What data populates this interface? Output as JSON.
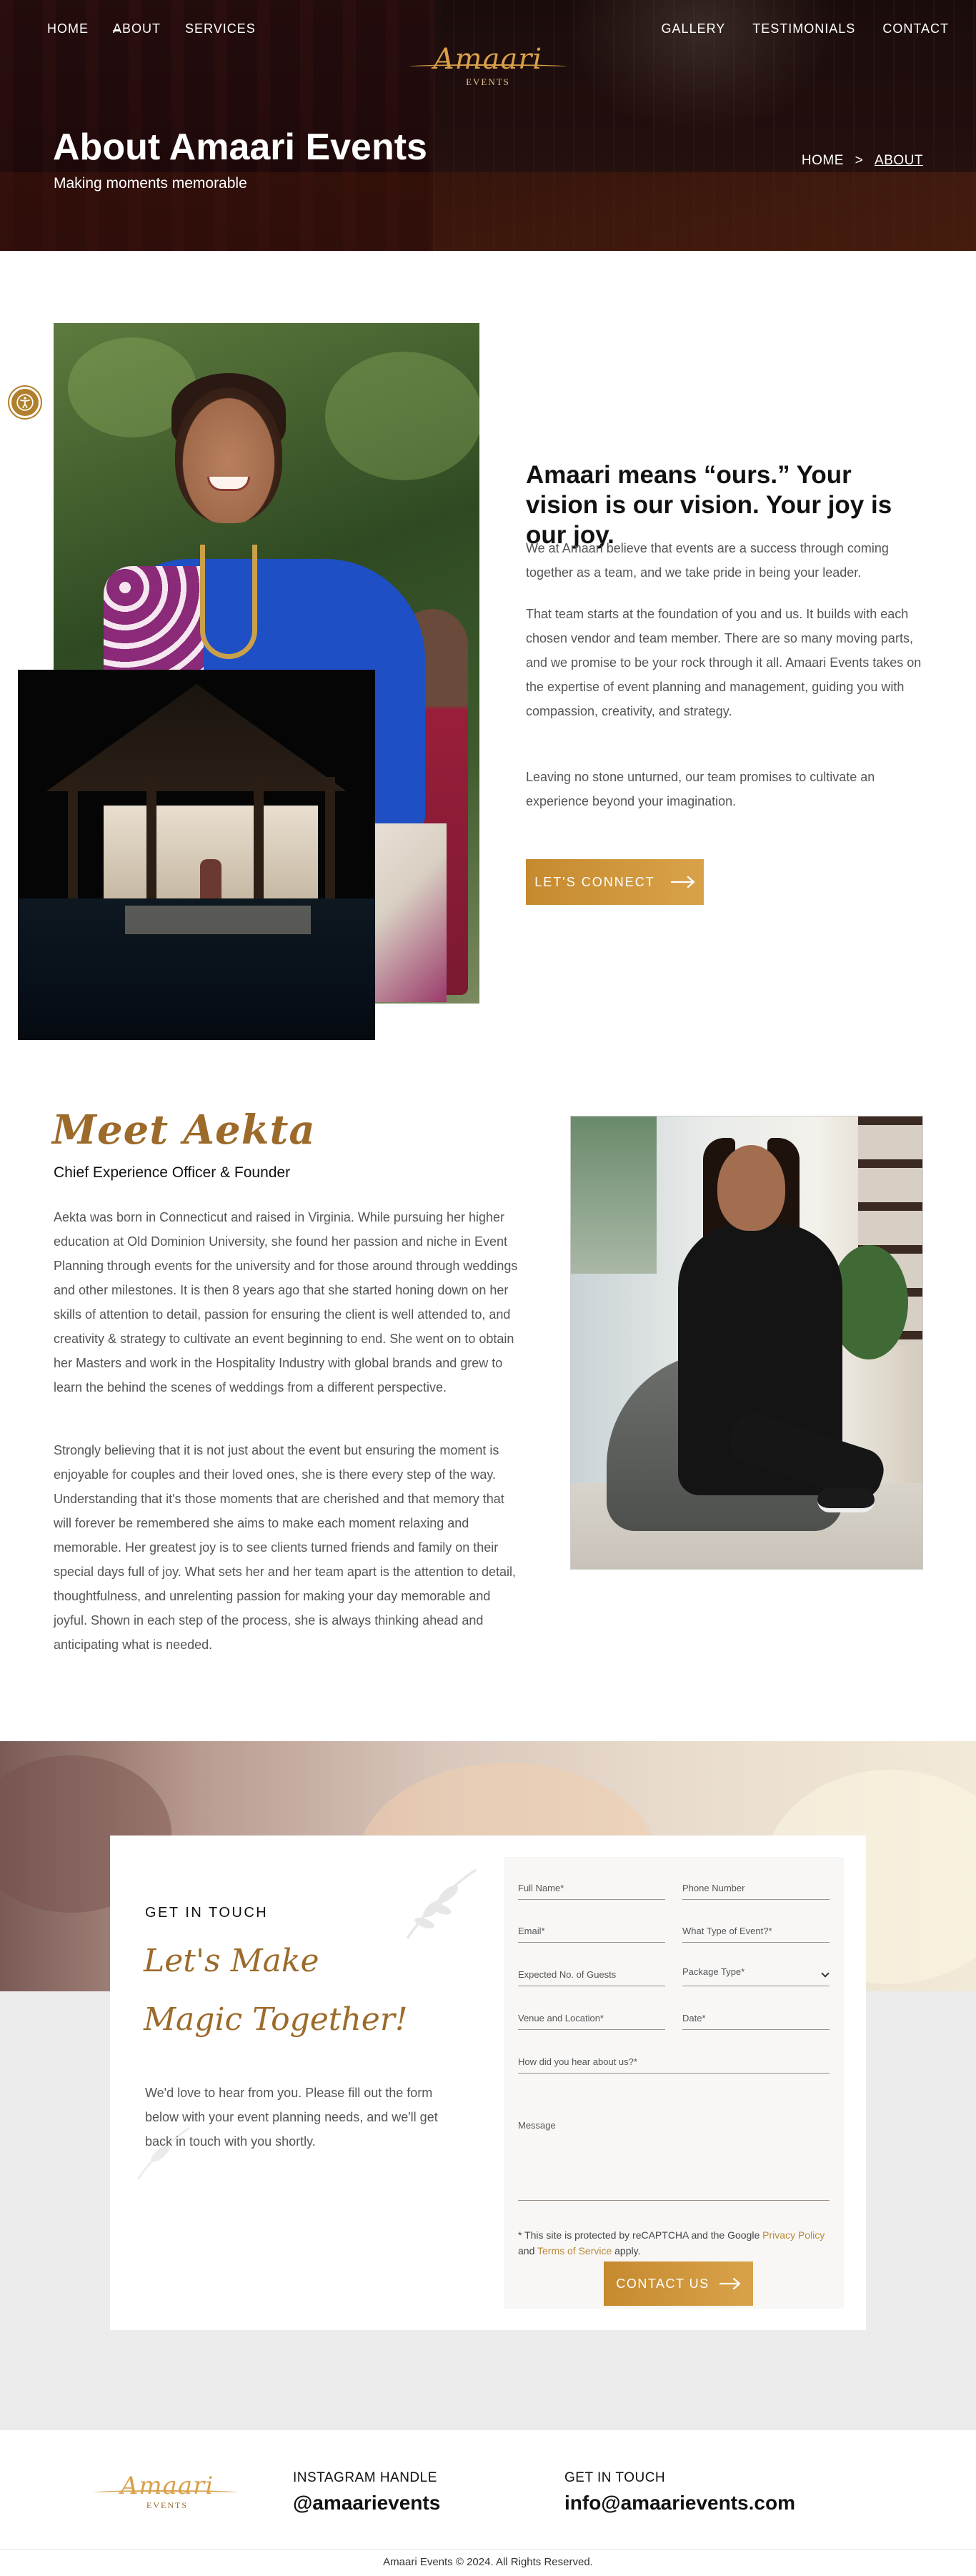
{
  "nav": {
    "left": [
      "HOME",
      "ABOUT",
      "SERVICES"
    ],
    "right": [
      "GALLERY",
      "TESTIMONIALS",
      "CONTACT"
    ],
    "active": "ABOUT"
  },
  "logo": {
    "script": "Amaari",
    "sub": "EVENTS"
  },
  "hero": {
    "title": "About Amaari Events",
    "subtitle": "Making moments memorable",
    "breadcrumb": {
      "home": "HOME",
      "separator": ">",
      "current": "ABOUT"
    }
  },
  "about": {
    "heading": "Amaari means “ours.” Your vision is our vision. Your joy is our joy.",
    "paragraphs": [
      "We at Amaari believe that events are a success through coming together as a team, and we take pride in being your leader.",
      "That team starts at the foundation of you and us. It builds with each chosen vendor and team member. There are so many moving parts, and we promise to be your rock through it all. Amaari Events takes on the expertise of event planning and management, guiding you with compassion, creativity, and strategy.",
      "Leaving no stone unturned, our team promises to cultivate an experience beyond your imagination."
    ],
    "cta": "LET'S CONNECT"
  },
  "meet": {
    "title": "Meet Aekta",
    "role": "Chief Experience Officer & Founder",
    "paragraphs": [
      "Aekta was born in Connecticut and raised in Virginia. While pursuing her higher education at Old Dominion University, she found her passion and niche in Event Planning through events for the university and for those around through weddings and other milestones. It is then 8 years ago that she started honing down on her skills of attention to detail, passion for ensuring the client is well attended to, and creativity & strategy to cultivate an event beginning to end. She went on to obtain her Masters and work in the Hospitality Industry with global brands and grew to learn the behind the scenes of weddings from a different perspective.",
      "Strongly believing that it is not just about the event but ensuring the moment is enjoyable for couples and their loved ones, she is there every step of the way. Understanding that it's those moments that are cherished and that memory that will forever be remembered she aims to make each moment relaxing and memorable. Her greatest joy is to see clients turned friends and family on their special days full of joy. What sets her and her team apart is the attention to detail, thoughtfulness, and unrelenting passion for making your day memorable and joyful. Shown in each step of the process, she is always thinking ahead and anticipating what is needed."
    ]
  },
  "contact": {
    "eyebrow": "GET IN TOUCH",
    "script_line1": "Let's Make",
    "script_line2": "Magic Together!",
    "text": "We'd love to hear from you. Please fill out the form below with your event planning needs, and we'll get back in touch with you shortly.",
    "fields": {
      "full_name": "Full Name*",
      "phone": "Phone Number",
      "email": "Email*",
      "event_type": "What Type of Event?*",
      "guests": "Expected No. of Guests",
      "package": "Package Type*",
      "venue": "Venue and Location*",
      "date": "Date*",
      "referral": "How did you hear about us?*",
      "message": "Message"
    },
    "recaptcha": {
      "prefix": "* This site is protected by reCAPTCHA and the Google ",
      "privacy": "Privacy Policy",
      "and": " and ",
      "terms": "Terms of Service",
      "suffix": " apply."
    },
    "submit": "CONTACT US"
  },
  "footer": {
    "instagram_label": "INSTAGRAM HANDLE",
    "instagram_value": "@amaarievents",
    "email_label": "GET IN TOUCH",
    "email_value": "info@amaarievents.com",
    "copyright": "Amaari Events © 2024. All Rights Reserved."
  },
  "icons": {
    "accessibility": "accessibility-icon",
    "arrow": "arrow-right-icon",
    "chevron": "chevron-down-icon",
    "leaf": "leaf-icon"
  },
  "colors": {
    "accent": "#c68a2e",
    "script": "#9c6a2a",
    "hero_overlay": "#1e0a0b"
  }
}
